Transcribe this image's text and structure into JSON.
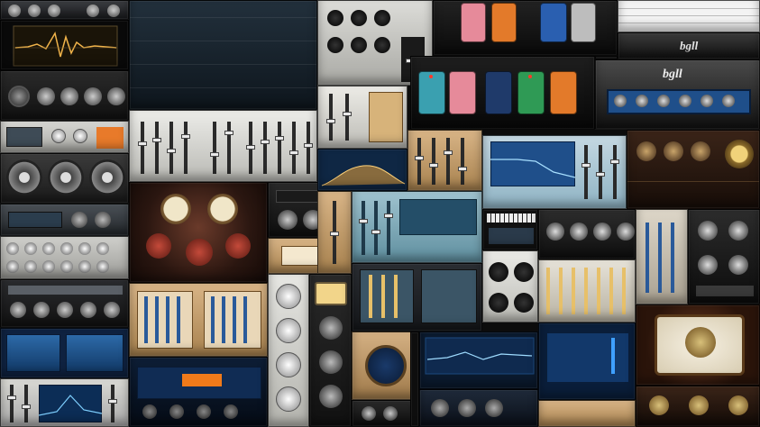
{
  "colors": {
    "background": "#101010",
    "silver": "#c9c9c4",
    "dark_panel": "#1c1e22",
    "tan_panel": "#c8a57a",
    "blue_screen": "#1f4f8a",
    "teal_screen": "#7db3c7",
    "amber_meter": "#e8c069",
    "red_pedal": "#d84a3a",
    "green_pedal": "#2f9a55",
    "orange_pedal": "#e37a2a",
    "pink_pedal": "#e68a9a",
    "yellow_pedal": "#e7c43a"
  },
  "logos": {
    "amp_top_right": "bgll",
    "amp_right": "bgll",
    "pedalboard_right": "bgll"
  }
}
